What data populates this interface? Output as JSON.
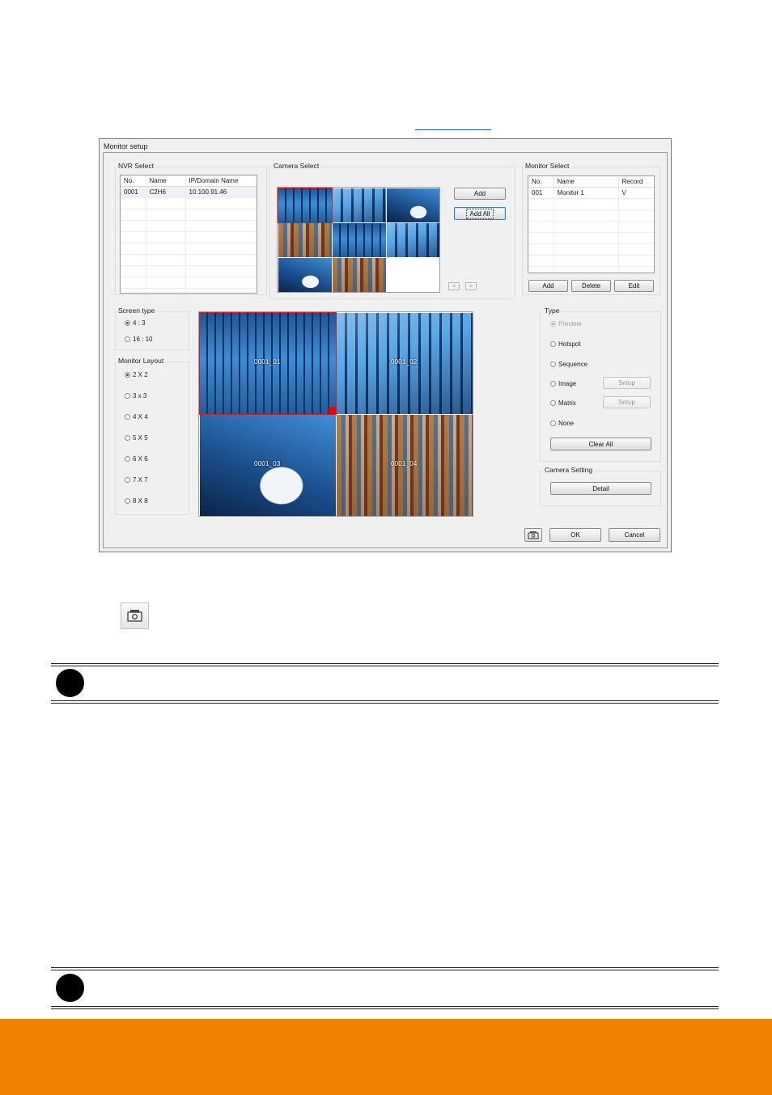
{
  "dialog": {
    "title": "Monitor setup",
    "nvr_select": {
      "label": "NVR Select",
      "columns": [
        "No.",
        "Name",
        "IP/Domain Name"
      ],
      "rows": [
        [
          "0001",
          "C2H6",
          "10.100.91.46"
        ]
      ]
    },
    "camera_select": {
      "label": "Camera Select",
      "add_label": "Add",
      "add_all_label": "Add All",
      "prev_label": "<",
      "next_label": ">"
    },
    "monitor_select": {
      "label": "Monitor Select",
      "columns": [
        "No.",
        "Name",
        "Record"
      ],
      "rows": [
        [
          "001",
          "Monitor 1",
          "V"
        ]
      ],
      "add_label": "Add",
      "delete_label": "Delete",
      "edit_label": "Edit"
    },
    "screen_type": {
      "label": "Screen type",
      "options": [
        "4 : 3",
        "16 : 10"
      ],
      "selected": "4 : 3"
    },
    "monitor_layout": {
      "label": "Monitor Layout",
      "options": [
        "2 X 2",
        "3 x 3",
        "4 X 4",
        "5 X 5",
        "6 X 6",
        "7 X 7",
        "8 X 8"
      ],
      "selected": "2 X 2"
    },
    "preview_tiles": [
      "0001_01",
      "0001_02",
      "0001_03",
      "0001_04"
    ],
    "type": {
      "label": "Type",
      "preview": "Preview",
      "hotspot": "Hotspot",
      "sequence": "Sequence",
      "image": "Image",
      "matrix": "Matrix",
      "none": "None",
      "setup_label": "Setup",
      "clear_all_label": "Clear All"
    },
    "camera_setting": {
      "label": "Camera Setting",
      "detail_label": "Detail"
    },
    "ok_label": "OK",
    "cancel_label": "Cancel"
  },
  "colors": {
    "footer": "#ef8200",
    "selection": "#d21b1b",
    "link": "#1a57d6"
  },
  "icons": {
    "snapshot_button": "camera-screen-icon",
    "note_bullets": "black-circle"
  }
}
